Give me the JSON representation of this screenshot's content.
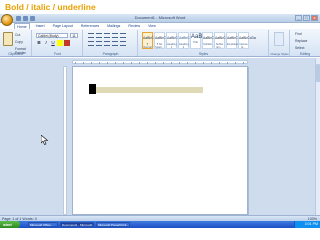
{
  "caption": "Bold / italic / underline",
  "window": {
    "title": "Document1 - Microsoft Word",
    "controls": {
      "minimize": "_",
      "maximize": "□",
      "close": "x"
    }
  },
  "tabs": [
    "Home",
    "Insert",
    "Page Layout",
    "References",
    "Mailings",
    "Review",
    "View"
  ],
  "ribbon": {
    "clipboard": {
      "paste": "Paste",
      "cut": "Cut",
      "copy": "Copy",
      "format_painter": "Format Painter",
      "label": "Clipboard"
    },
    "font": {
      "name": "Calibri (Body)",
      "size": "11",
      "bold": "B",
      "italic": "I",
      "underline": "U",
      "label": "Font"
    },
    "paragraph": {
      "label": "Paragraph"
    },
    "styles": {
      "items": [
        {
          "preview": "AaBbCcDc",
          "name": "¶ Normal"
        },
        {
          "preview": "AaBbCcDc",
          "name": "¶ No Spaci..."
        },
        {
          "preview": "AaBbCc",
          "name": "Heading 1"
        },
        {
          "preview": "AaBbCc",
          "name": "Heading 2"
        },
        {
          "preview": "AaB",
          "name": "Title"
        },
        {
          "preview": "AaBbCc.",
          "name": "Subtitle"
        },
        {
          "preview": "AaBbCcDa",
          "name": "Subtle Em..."
        },
        {
          "preview": "AaBbCcDa",
          "name": "Emphasis"
        },
        {
          "preview": "AaBbCcDa",
          "name": "Intense E..."
        }
      ],
      "change_styles": "Change Styles",
      "label": "Styles"
    },
    "editing": {
      "find": "Find",
      "replace": "Replace",
      "select": "Select",
      "label": "Editing"
    }
  },
  "status": {
    "page": "Page: 1 of 1",
    "words": "Words: 0",
    "zoom": "100%"
  },
  "taskbar": {
    "start": "start",
    "tasks": [
      "Microsoft Office...",
      "Document1 - Microsoft...",
      "Microsoft PowerPoint..."
    ],
    "clock": "3:01 PM"
  },
  "colors": {
    "caption": "#e8a000",
    "ribbon": "#d5e3f4",
    "highlight": "#e0d9b6",
    "taskbar": "#1d4fc4"
  }
}
